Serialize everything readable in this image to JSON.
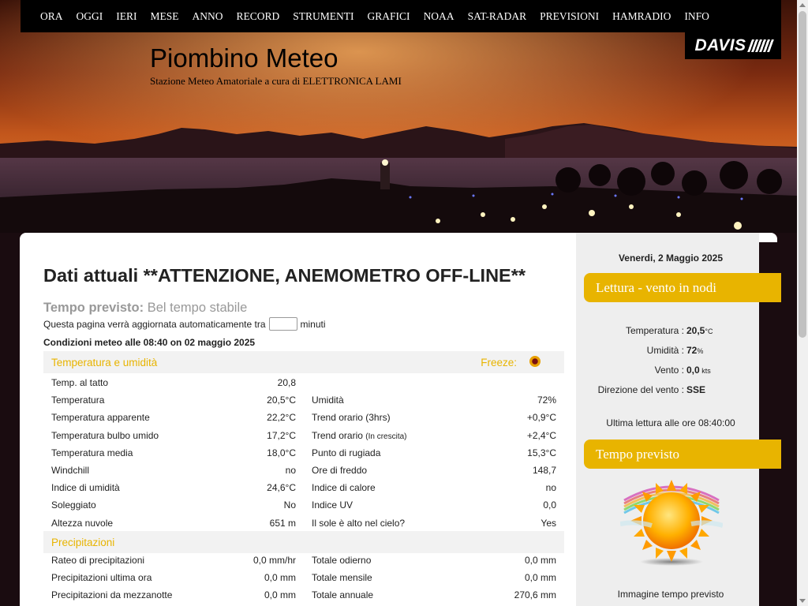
{
  "nav": [
    "ORA",
    "OGGI",
    "IERI",
    "MESE",
    "ANNO",
    "RECORD",
    "STRUMENTI",
    "GRAFICI",
    "NOAA",
    "SAT-RADAR",
    "PREVISIONI",
    "HAMRADIO",
    "INFO"
  ],
  "logo_text": "DAVIS",
  "site": {
    "title": "Piombino Meteo",
    "subtitle": "Stazione Meteo Amatoriale a cura di ELETTRONICA LAMI"
  },
  "main": {
    "heading": "Dati attuali **ATTENZIONE, ANEMOMETRO OFF-LINE**",
    "forecast_label": "Tempo previsto:",
    "forecast_value": "Bel tempo stabile",
    "refresh_before": "Questa pagina verrà aggiornata automaticamente tra",
    "refresh_value": "",
    "refresh_after": "minuti",
    "conditions": "Condizioni meteo alle 08:40 on 02 maggio 2025",
    "sec_temp": "Temperatura e umidità",
    "freeze_label": "Freeze:",
    "temp_rows": [
      {
        "l1": "Temp. al tatto",
        "v1": "20,8",
        "l2": "",
        "v2": ""
      },
      {
        "l1": "Temperatura",
        "v1": "20,5°C",
        "l2": "Umidità",
        "v2": "72%"
      },
      {
        "l1": "Temperatura apparente",
        "v1": "22,2°C",
        "l2": "Trend orario (3hrs)",
        "v2": "+0,9°C"
      },
      {
        "l1": "Temperatura bulbo umido",
        "v1": "17,2°C",
        "l2": "Trend orario",
        "l2_small": "(In crescita)",
        "v2": "+2,4°C"
      },
      {
        "l1": "Temperatura media",
        "v1": "18,0°C",
        "l2": "Punto di rugiada",
        "v2": "15,3°C"
      },
      {
        "l1": "Windchill",
        "v1": "no",
        "l2": "Ore di freddo",
        "v2": "148,7"
      },
      {
        "l1": "Indice di umidità",
        "v1": "24,6°C",
        "l2": "Indice di calore",
        "v2": "no"
      },
      {
        "l1": "Soleggiato",
        "v1": "No",
        "l2": "Indice UV",
        "v2": "0,0"
      },
      {
        "l1": "Altezza nuvole",
        "v1": "651 m",
        "l2": "Il sole è alto nel cielo?",
        "v2": "Yes"
      }
    ],
    "sec_rain": "Precipitazioni",
    "rain_rows": [
      {
        "l1": "Rateo di precipitazioni",
        "v1": "0,0 mm/hr",
        "l2": "Totale odierno",
        "v2": "0,0 mm"
      },
      {
        "l1": "Precipitazioni ultima ora",
        "v1": "0,0 mm",
        "l2": "Totale mensile",
        "v2": "0,0 mm"
      },
      {
        "l1": "Precipitazioni da mezzanotte",
        "v1": "0,0 mm",
        "l2": "Totale annuale",
        "v2": "270,6 mm"
      }
    ]
  },
  "side": {
    "date": "Venerdi, 2 Maggio 2025",
    "box1": "Lettura - vento in nodi",
    "readings": [
      {
        "label": "Temperatura :",
        "value": "20,5",
        "unit": "°C"
      },
      {
        "label": "Umidità :",
        "value": "72",
        "unit": "%"
      },
      {
        "label": "Vento :",
        "value": "0,0",
        "unit": " kts"
      },
      {
        "label": "Direzione del vento :",
        "value": "SSE",
        "unit": ""
      }
    ],
    "last_read": "Ultima lettura alle ore 08:40:00",
    "box2": "Tempo previsto",
    "image_caption": "Immagine tempo previsto"
  }
}
